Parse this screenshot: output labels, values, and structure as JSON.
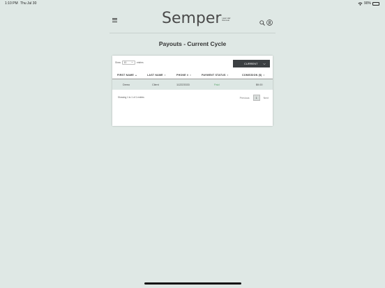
{
  "status_bar": {
    "time": "1:10 PM",
    "date": "Thu Jul 30",
    "battery": "90%"
  },
  "header": {
    "logo_text": "Semper",
    "logo_tagline": "Laser Hair Removal"
  },
  "page_title": "Payouts - Current Cycle",
  "controls": {
    "show_label": "Show",
    "entries_value": "10",
    "entries_label": "entries",
    "cycle_value": "CURRENT"
  },
  "table": {
    "columns": [
      "FIRST NAME",
      "LAST NAME",
      "PHONE #",
      "PAYMENT STATUS",
      "COMISSION ($)"
    ],
    "rows": [
      [
        "Demo",
        "Client",
        "112223333",
        "Paid",
        "$9.00"
      ]
    ]
  },
  "footer": {
    "info": "Showing 1 to 1 of 1 entries",
    "prev_label": "Previous",
    "current_page": "1",
    "next_label": "Next"
  },
  "colors": {
    "background": "#dfe8e5",
    "paid": "#5aa46a",
    "dark_button": "#3b3f42"
  }
}
